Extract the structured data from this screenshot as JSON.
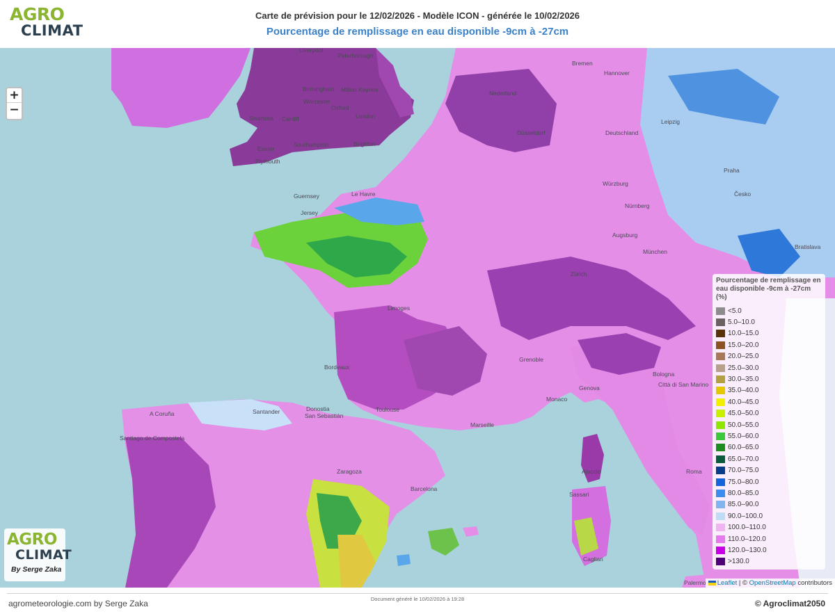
{
  "header": {
    "title_line1": "Carte de prévision pour le 12/02/2026 - Modèle ICON - générée le 10/02/2026",
    "title_line2": "Pourcentage de remplissage en eau disponible -9cm à -27cm",
    "logo_agro": "AGRO",
    "logo_climat": "CLIMAT"
  },
  "zoom": {
    "in_label": "+",
    "out_label": "−"
  },
  "legend": {
    "title": "Pourcentage de remplissage en eau disponible -9cm à -27cm (%)",
    "items": [
      {
        "label": "<5.0",
        "color": "#8c8c8c"
      },
      {
        "label": "5.0–10.0",
        "color": "#6b6160"
      },
      {
        "label": "10.0–15.0",
        "color": "#5a3208"
      },
      {
        "label": "15.0–20.0",
        "color": "#8c5220"
      },
      {
        "label": "20.0–25.0",
        "color": "#a87858"
      },
      {
        "label": "25.0–30.0",
        "color": "#b8a08a"
      },
      {
        "label": "30.0–35.0",
        "color": "#b4a040"
      },
      {
        "label": "35.0–40.0",
        "color": "#e6c800"
      },
      {
        "label": "40.0–45.0",
        "color": "#f0f000"
      },
      {
        "label": "45.0–50.0",
        "color": "#c8f000"
      },
      {
        "label": "50.0–55.0",
        "color": "#90e600"
      },
      {
        "label": "55.0–60.0",
        "color": "#3cc83c"
      },
      {
        "label": "60.0–65.0",
        "color": "#1e8c1e"
      },
      {
        "label": "65.0–70.0",
        "color": "#0a5a3c"
      },
      {
        "label": "70.0–75.0",
        "color": "#0a3c8c"
      },
      {
        "label": "75.0–80.0",
        "color": "#1464dc"
      },
      {
        "label": "80.0–85.0",
        "color": "#3c8cf0"
      },
      {
        "label": "85.0–90.0",
        "color": "#82b4f0"
      },
      {
        "label": "90.0–100.0",
        "color": "#bedcf5"
      },
      {
        "label": "100.0–110.0",
        "color": "#f0b4f0"
      },
      {
        "label": "110.0–120.0",
        "color": "#e678f0"
      },
      {
        "label": "120.0–130.0",
        "color": "#c800e6"
      },
      {
        "label": ">130.0",
        "color": "#500078"
      }
    ]
  },
  "cities": [
    {
      "name": "Liverpool"
    },
    {
      "name": "Birmingham"
    },
    {
      "name": "Peterborough"
    },
    {
      "name": "Milton Keynes"
    },
    {
      "name": "Worcester"
    },
    {
      "name": "Oxford"
    },
    {
      "name": "London"
    },
    {
      "name": "Swansea"
    },
    {
      "name": "Cardiff"
    },
    {
      "name": "Southampton"
    },
    {
      "name": "Brighton"
    },
    {
      "name": "Exeter"
    },
    {
      "name": "Plymouth"
    },
    {
      "name": "Guernsey"
    },
    {
      "name": "Jersey"
    },
    {
      "name": "Le Havre"
    },
    {
      "name": "Bremen"
    },
    {
      "name": "Hannover"
    },
    {
      "name": "Nederland"
    },
    {
      "name": "Leipzig"
    },
    {
      "name": "Düsseldorf"
    },
    {
      "name": "Deutschland"
    },
    {
      "name": "Praha"
    },
    {
      "name": "Česko"
    },
    {
      "name": "Würzburg"
    },
    {
      "name": "Nürnberg"
    },
    {
      "name": "Augsburg"
    },
    {
      "name": "München"
    },
    {
      "name": "Bratislava"
    },
    {
      "name": "Zürich"
    },
    {
      "name": "Limoges"
    },
    {
      "name": "Bordeaux"
    },
    {
      "name": "Grenoble"
    },
    {
      "name": "Bologna"
    },
    {
      "name": "Città di San Marino"
    },
    {
      "name": "Genova"
    },
    {
      "name": "Monaco"
    },
    {
      "name": "Toulouse"
    },
    {
      "name": "Marseille"
    },
    {
      "name": "Donostia"
    },
    {
      "name": "San Sebastián"
    },
    {
      "name": "Santander"
    },
    {
      "name": "A Coruña"
    },
    {
      "name": "Santiago de Compostela"
    },
    {
      "name": "Zaragoza"
    },
    {
      "name": "Barcelona"
    },
    {
      "name": "Ajaccio"
    },
    {
      "name": "Roma"
    },
    {
      "name": "Sassari"
    },
    {
      "name": "Cagliari"
    },
    {
      "name": "Palermo"
    }
  ],
  "attribution": {
    "leaflet": "Leaflet",
    "sep": " | © ",
    "osm": "OpenStreetMap",
    "contrib": " contributors"
  },
  "logo_box": {
    "agro": "AGRO",
    "climat": "CLIMAT",
    "by": "By Serge Zaka"
  },
  "footer": {
    "left": "agrometeorologie.com by Serge Zaka",
    "center": "Document généré le 10/02/2026 à 19:28",
    "right": "© Agroclimat2050"
  },
  "colors": {
    "sea": "#a9d2dd",
    "title_blue": "#3b82c8",
    "logo_green": "#8bb431",
    "logo_dark": "#2b3f4f"
  }
}
